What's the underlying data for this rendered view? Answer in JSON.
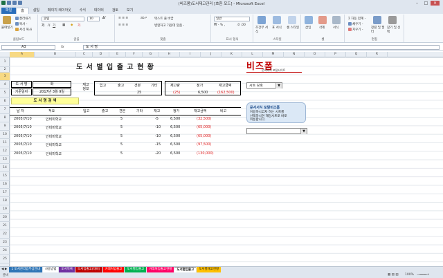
{
  "window": {
    "title": "(비즈폼)도서재고관리 [호환 모드] - Microsoft Excel"
  },
  "tabs": [
    "파일",
    "홈",
    "삽입",
    "페이지 레이아웃",
    "수식",
    "데이터",
    "검토",
    "보기"
  ],
  "ribbon": {
    "clipboard": {
      "paste": "붙여넣기",
      "cut": "잘라내기",
      "copy": "복사 -",
      "format_painter": "서식 복사",
      "label": "클립보드"
    },
    "font": {
      "name": "굴림",
      "size": "10",
      "label": "글꼴"
    },
    "alignment": {
      "wrap": "텍스트 줄 바꿈",
      "merge": "병합하고 가운데 맞춤 -",
      "label": "맞춤"
    },
    "number": {
      "format": "일반",
      "label": "표시 형식"
    },
    "styles": {
      "cond": "조건부 서식",
      "table": "표 서식",
      "cell": "셀 스타일",
      "label": "스타일"
    },
    "cells": {
      "insert": "삽입",
      "delete": "삭제",
      "format": "서식",
      "label": "셀"
    },
    "editing": {
      "autosum": "자동 합계 -",
      "fill": "채우기 -",
      "clear": "지우기 -",
      "sort": "정렬 및 필터",
      "find": "찾기 및 선택",
      "label": "편집"
    }
  },
  "formula_bar": {
    "name_box": "A3",
    "fx": "fx",
    "formula": "도 서 명"
  },
  "columns": [
    "A",
    "B",
    "C",
    "D",
    "E",
    "F",
    "G",
    "H",
    "I",
    "J",
    "K",
    "L",
    "M",
    "N",
    "O",
    "P",
    "Q",
    "R"
  ],
  "rows": [
    "1",
    "2",
    "3",
    "4",
    "5",
    "6",
    "7",
    "8",
    "9",
    "10",
    "11",
    "12",
    "13",
    "14",
    "15",
    "16",
    "17",
    "18",
    "19",
    "20",
    "21",
    "22",
    "23",
    "24",
    "25"
  ],
  "sheet": {
    "title": "도 서 별 입 출 고 현 황",
    "book_label": "도 서 명",
    "book_name": "화",
    "date_label": "기준일자",
    "date_value": "2017년 3월 9일",
    "receive_label": "재고\n정보",
    "hdr_in": "입고",
    "hdr_out": "출고",
    "hdr_return": "견본",
    "hdr_etc": "기타",
    "hdr_stock": "재고량",
    "hdr_price": "정가",
    "hdr_amount": "재고금액",
    "val_return": "25",
    "val_stock": "(25)",
    "val_price": "6,500",
    "val_amount": "(162,500)",
    "search_btn": "도 서 명 검 색",
    "table_headers": [
      "날 자",
      "적요",
      "입고",
      "출고",
      "견본",
      "기타",
      "재고",
      "정가",
      "재고금액",
      "비고"
    ],
    "rows": [
      {
        "date": "2005/7/10",
        "desc": "인비미학교",
        "ret": "5",
        "stock": "-5",
        "price": "6,500",
        "amount": "(32,500)"
      },
      {
        "date": "2005/7/10",
        "desc": "인비미학교",
        "ret": "5",
        "stock": "-10",
        "price": "6,500",
        "amount": "(65,000)"
      },
      {
        "date": "2005/7/10",
        "desc": "인비미학교",
        "ret": "5",
        "stock": "-10",
        "price": "6,500",
        "amount": "(65,000)"
      },
      {
        "date": "2005/7/10",
        "desc": "인비미학교",
        "ret": "5",
        "stock": "-15",
        "price": "6,500",
        "amount": "(97,500)"
      },
      {
        "date": "2005/7/10",
        "desc": "인비미학교",
        "ret": "5",
        "stock": "-20",
        "price": "6,500",
        "amount": "(130,000)"
      }
    ],
    "logo": "비즈폼",
    "logo_sub": "문서서식 포털사이트",
    "protect_label": "시트 보호",
    "info_title": "문서서식 포탈비즈폼",
    "info_text": "이용하시고자 하는 시트를\n선택하시면 해당시트로 바로\n이동합니다."
  },
  "sheet_tabs": [
    {
      "label": "1 도서관리업무상안내",
      "color": "#2e75b6"
    },
    {
      "label": "사용방법",
      "color": "#ffffff"
    },
    {
      "label": "도서목록",
      "color": "#7030a0"
    },
    {
      "label": "도서입출고(대비)",
      "color": "#c00000"
    },
    {
      "label": "거래처입출고",
      "color": "#ff0000"
    },
    {
      "label": "도서별입출고",
      "color": "#00b050"
    },
    {
      "label": "거래처입출고현황",
      "color": "#ff0066"
    },
    {
      "label": "도서별입출고",
      "color": "#ffffff"
    },
    {
      "label": "도서별재고현황",
      "color": "#ffc000"
    }
  ],
  "status": {
    "ready": "준비",
    "zoom": "100%"
  }
}
